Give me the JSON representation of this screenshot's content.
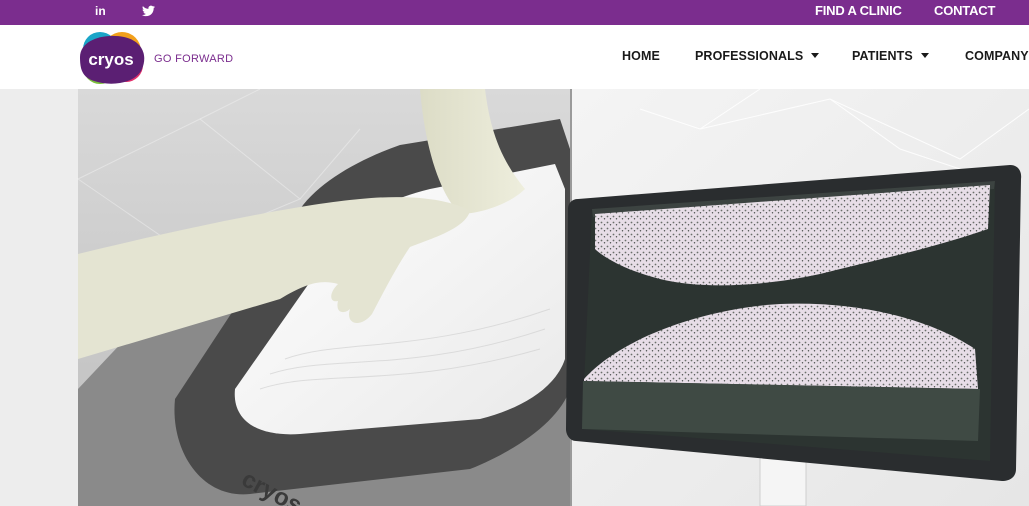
{
  "topbar": {
    "social": [
      {
        "label": "in",
        "icon": "linkedin-icon"
      },
      {
        "label": "",
        "icon": "twitter-icon"
      }
    ],
    "links": [
      "FIND A CLINIC",
      "CONTACT"
    ]
  },
  "brand": {
    "logo_text": "cryos",
    "tagline": "GO FORWARD",
    "primary_color": "#7b2d8e"
  },
  "nav": {
    "items": [
      {
        "label": "HOME",
        "has_dropdown": false
      },
      {
        "label": "PROFESSIONALS",
        "has_dropdown": true
      },
      {
        "label": "PATIENTS",
        "has_dropdown": true
      },
      {
        "label": "COMPANY",
        "has_dropdown": false
      }
    ]
  },
  "hero": {
    "device_logo_text": "cryos"
  }
}
